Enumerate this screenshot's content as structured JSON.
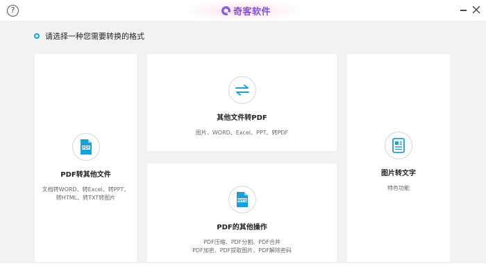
{
  "titlebar": {
    "help_glyph": "?",
    "brand_name": "奇客软件",
    "brand_color": "#7d56d9"
  },
  "prompt": {
    "text": "请选择一种您需要转换的格式",
    "accent": "#1a9fd6"
  },
  "cards": {
    "pdf_to_other": {
      "icon": "pdf-file-icon",
      "title": "PDF转其他文件",
      "desc_lines": [
        "文档转WORD、转Excel、转PPT、",
        "转HTML、转TXT转图片"
      ]
    },
    "other_to_pdf": {
      "icon": "swap-arrows-icon",
      "title": "其他文件转PDF",
      "desc_lines": [
        "图片、WORD、Excel、PPT、转PDF"
      ]
    },
    "pdf_ops": {
      "icon": "wps-file-icon",
      "title": "PDF的其他操作",
      "desc_lines": [
        "PDF压缩、PDF分割、PDF合并",
        "PDF加密、PDF提取图片、PDF解除密码"
      ]
    },
    "img_to_text": {
      "icon": "image-text-doc-icon",
      "title": "图片转文字",
      "desc_lines": [
        "特色功能"
      ]
    }
  }
}
